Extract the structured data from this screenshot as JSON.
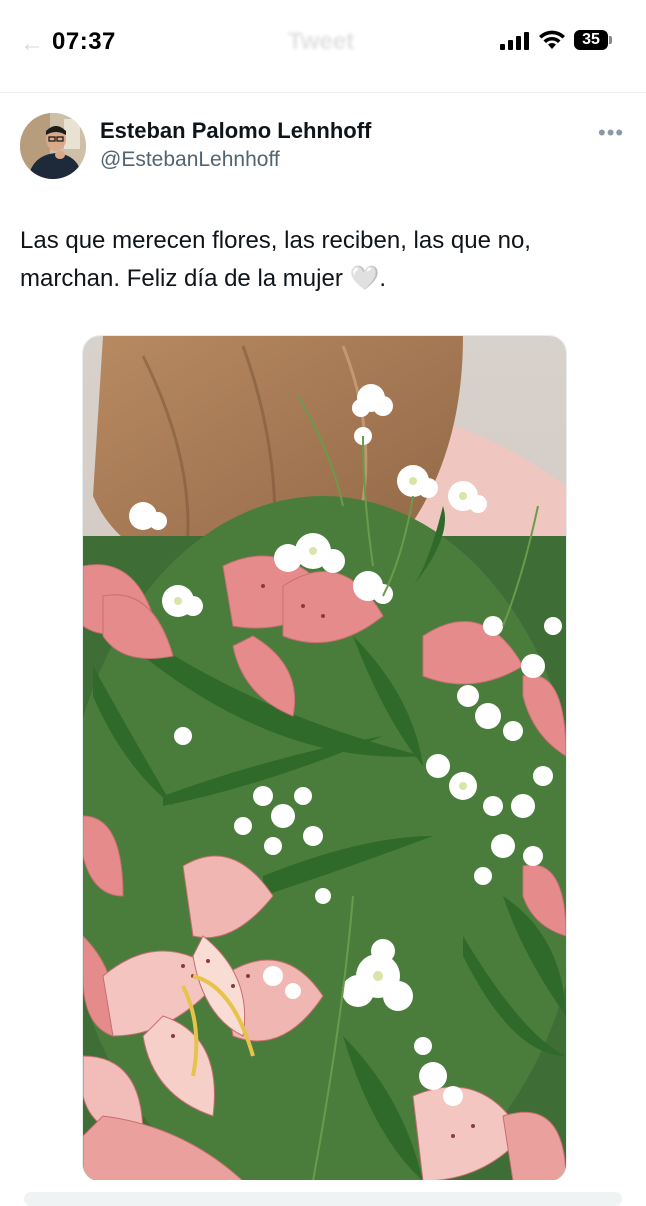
{
  "status_bar": {
    "time": "07:37",
    "battery": "35",
    "signal_icon": "cellular-signal-icon",
    "wifi_icon": "wifi-icon",
    "battery_icon": "battery-icon"
  },
  "header": {
    "title": "Tweet",
    "back_icon": "back-arrow-icon"
  },
  "tweet": {
    "author_name": "Esteban Palomo Lehnhoff",
    "author_handle": "@EstebanLehnhoff",
    "text_before_emoji": "Las que merecen flores, las reciben, las que no, marchan. Feliz día de la mujer ",
    "emoji": "🤍",
    "text_after_emoji": ".",
    "more_icon": "more-options-icon",
    "media_description_icon": "photo-flower-bouquet"
  },
  "colors": {
    "text_primary": "#0f1419",
    "text_secondary": "#536471",
    "divider": "#eff3f4"
  }
}
